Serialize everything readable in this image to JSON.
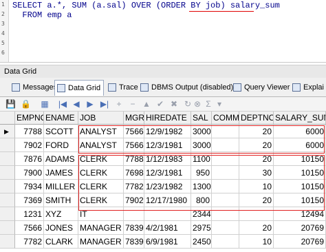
{
  "editor": {
    "line_numbers": [
      "1",
      "2",
      "3",
      "4",
      "5",
      "6"
    ],
    "line1": "SELECT a.*, SUM (a.sal) OVER (ORDER BY job) salary_sum",
    "line2": "  FROM emp a"
  },
  "panel": {
    "title": "Data Grid"
  },
  "tabs": [
    {
      "label": "Messages",
      "icon": "messages-icon"
    },
    {
      "label": "Data Grid",
      "icon": "data-grid-icon"
    },
    {
      "label": "Trace",
      "icon": "trace-icon"
    },
    {
      "label": "DBMS Output (disabled)",
      "icon": "dbms-output-icon"
    },
    {
      "label": "Query Viewer",
      "icon": "query-viewer-icon"
    },
    {
      "label": "Explai",
      "icon": "explain-icon"
    }
  ],
  "toolbar": {
    "icons": [
      "save-icon",
      "lock-icon",
      "grid-options-icon",
      "first-record-icon",
      "prior-record-icon",
      "next-record-icon",
      "last-record-icon",
      "insert-record-icon",
      "delete-record-icon",
      "edit-record-icon",
      "post-edit-icon",
      "cancel-edit-icon",
      "refresh-icon",
      "filter-icon",
      "sum-icon",
      "sort-icon"
    ],
    "glyphs": [
      "💾",
      "🔒",
      "▦",
      "|◀",
      "◀",
      "▶",
      "▶|",
      "+",
      "−",
      "▲",
      "✔",
      "✖",
      "↻",
      "⊗",
      "Σ",
      "▾"
    ]
  },
  "grid": {
    "columns": [
      "EMPNO",
      "ENAME",
      "JOB",
      "MGR",
      "HIREDATE",
      "SAL",
      "COMM",
      "DEPTNO",
      "SALARY_SUM"
    ],
    "rows": [
      [
        "7788",
        "SCOTT",
        "ANALYST",
        "7566",
        "12/9/1982",
        "3000",
        "",
        "20",
        "6000"
      ],
      [
        "7902",
        "FORD",
        "ANALYST",
        "7566",
        "12/3/1981",
        "3000",
        "",
        "20",
        "6000"
      ],
      [
        "7876",
        "ADAMS",
        "CLERK",
        "7788",
        "1/12/1983",
        "1100",
        "",
        "20",
        "10150"
      ],
      [
        "7900",
        "JAMES",
        "CLERK",
        "7698",
        "12/3/1981",
        "950",
        "",
        "30",
        "10150"
      ],
      [
        "7934",
        "MILLER",
        "CLERK",
        "7782",
        "1/23/1982",
        "1300",
        "",
        "10",
        "10150"
      ],
      [
        "7369",
        "SMITH",
        "CLERK",
        "7902",
        "12/17/1980",
        "800",
        "",
        "20",
        "10150"
      ],
      [
        "1231",
        "XYZ",
        "IT",
        "",
        "",
        "2344",
        "",
        "",
        "12494"
      ],
      [
        "7566",
        "JONES",
        "MANAGER",
        "7839",
        "4/2/1981",
        "2975",
        "",
        "20",
        "20769"
      ],
      [
        "7782",
        "CLARK",
        "MANAGER",
        "7839",
        "6/9/1981",
        "2450",
        "",
        "10",
        "20769"
      ]
    ],
    "current_row_marker": "▶"
  },
  "colors": {
    "highlight": "#e02020",
    "keyword": "#0000cc"
  }
}
